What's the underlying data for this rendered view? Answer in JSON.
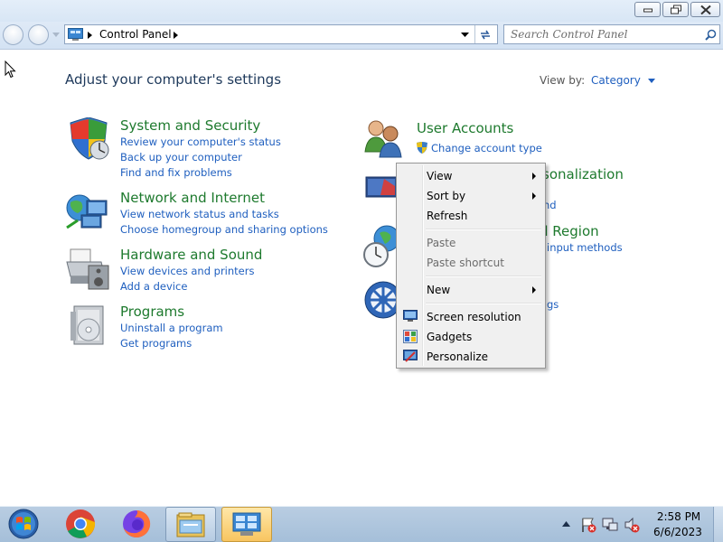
{
  "address": {
    "root_label": "Control Panel"
  },
  "search": {
    "placeholder": "Search Control Panel"
  },
  "main": {
    "heading": "Adjust your computer's settings",
    "view_by_label": "View by:",
    "view_by_value": "Category"
  },
  "categories": [
    {
      "title": "System and Security",
      "links": [
        "Review your computer's status",
        "Back up your computer",
        "Find and fix problems"
      ]
    },
    {
      "title": "Network and Internet",
      "links": [
        "View network status and tasks",
        "Choose homegroup and sharing options"
      ]
    },
    {
      "title": "Hardware and Sound",
      "links": [
        "View devices and printers",
        "Add a device"
      ]
    },
    {
      "title": "Programs",
      "links": [
        "Uninstall a program",
        "Get programs"
      ]
    },
    {
      "title": "User Accounts",
      "links": [
        "Change account type"
      ]
    },
    {
      "title_partial": "sonalization",
      "links_partial": [
        "nd"
      ]
    },
    {
      "title_partial": "d Region",
      "links_partial": [
        "input methods"
      ]
    },
    {
      "links_partial": [
        "gs"
      ]
    }
  ],
  "context_menu": {
    "items": [
      {
        "label": "View",
        "submenu": true
      },
      {
        "label": "Sort by",
        "submenu": true
      },
      {
        "label": "Refresh"
      },
      {
        "label": "Paste",
        "disabled": true
      },
      {
        "label": "Paste shortcut",
        "disabled": true
      },
      {
        "label": "New",
        "submenu": true
      },
      {
        "label": "Screen resolution",
        "icon": "screen-resolution-icon"
      },
      {
        "label": "Gadgets",
        "icon": "gadgets-icon"
      },
      {
        "label": "Personalize",
        "icon": "personalize-icon"
      }
    ]
  },
  "taskbar": {
    "time": "2:58 PM",
    "date": "6/6/2023",
    "pinned": [
      "start-orb-icon",
      "chrome-icon",
      "firefox-icon",
      "file-explorer-icon",
      "control-panel-icon"
    ]
  },
  "colors": {
    "category_title": "#1e7a2e",
    "link": "#1f5fbf",
    "heading": "#1e395b"
  }
}
